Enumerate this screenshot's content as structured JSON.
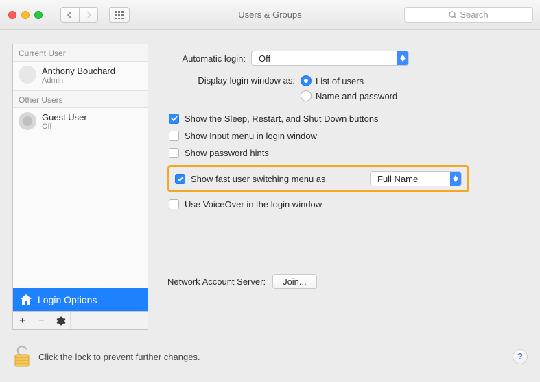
{
  "window": {
    "title": "Users & Groups",
    "search_placeholder": "Search"
  },
  "sidebar": {
    "current_header": "Current User",
    "other_header": "Other Users",
    "current_user": {
      "name": "Anthony Bouchard",
      "role": "Admin"
    },
    "other_users": [
      {
        "name": "Guest User",
        "role": "Off"
      }
    ],
    "login_options_label": "Login Options"
  },
  "main": {
    "automatic_login_label": "Automatic login:",
    "automatic_login_value": "Off",
    "display_login_label": "Display login window as:",
    "display_login_options": {
      "list": "List of users",
      "namepw": "Name and password"
    },
    "checkboxes": {
      "sleep_restart": "Show the Sleep, Restart, and Shut Down buttons",
      "input_menu": "Show Input menu in login window",
      "pw_hints": "Show password hints",
      "fast_user_switch": "Show fast user switching menu as",
      "voiceover": "Use VoiceOver in the login window"
    },
    "fast_user_switch_value": "Full Name",
    "network_server_label": "Network Account Server:",
    "join_button": "Join..."
  },
  "footer": {
    "lock_text": "Click the lock to prevent further changes."
  }
}
